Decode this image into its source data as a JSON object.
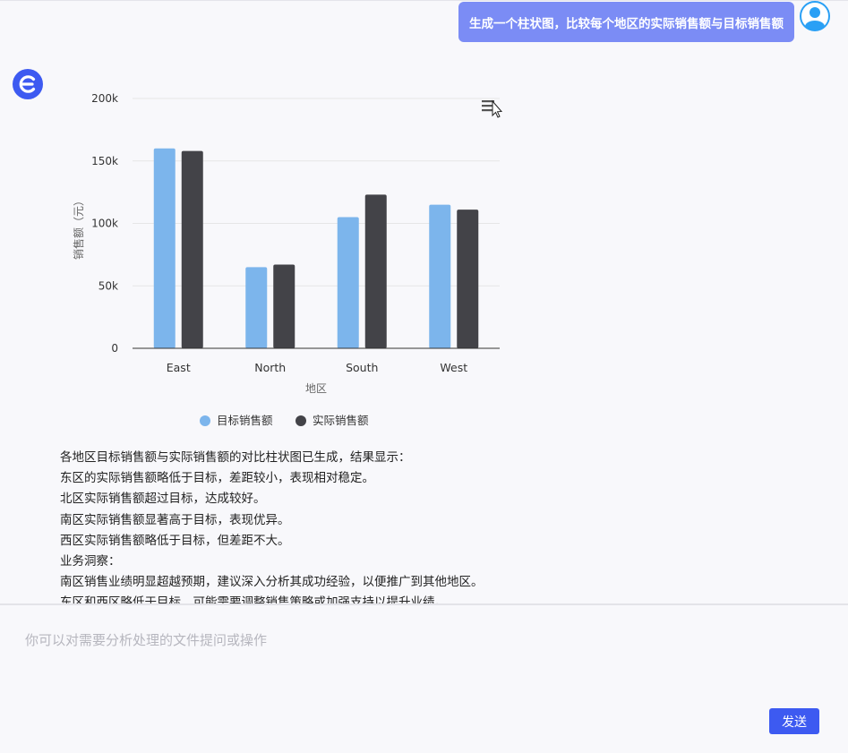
{
  "conversation": {
    "user_message": "生成一个柱状图，比较每个地区的实际销售额与目标销售额"
  },
  "chart_data": {
    "type": "bar",
    "categories": [
      "East",
      "North",
      "South",
      "West"
    ],
    "series": [
      {
        "name": "目标销售额",
        "values": [
          160000,
          65000,
          105000,
          115000
        ],
        "color": "#7cb5ec"
      },
      {
        "name": "实际销售额",
        "values": [
          158000,
          67000,
          123000,
          111000
        ],
        "color": "#434348"
      }
    ],
    "xlabel": "地区",
    "ylabel": "销售额（元）",
    "ylim": [
      0,
      200000
    ],
    "yticks": [
      "0",
      "50k",
      "100k",
      "150k",
      "200k"
    ],
    "grid": true,
    "legend": "bottom-center"
  },
  "chart_menu_icon": "hamburger-menu-icon",
  "answer": {
    "lines": [
      "各地区目标销售额与实际销售额的对比柱状图已生成，结果显示：",
      "东区的实际销售额略低于目标，差距较小，表现相对稳定。",
      "北区实际销售额超过目标，达成较好。",
      "南区实际销售额显著高于目标，表现优异。",
      "西区实际销售额略低于目标，但差距不大。",
      "业务洞察：",
      "南区销售业绩明显超越预期，建议深入分析其成功经验，以便推广到其他地区。",
      "东区和西区略低于目标，可能需要调整销售策略或加强支持以提升业绩。"
    ]
  },
  "input": {
    "placeholder": "你可以对需要分析处理的文件提问或操作"
  },
  "send_label": "发送",
  "colors": {
    "accent": "#3d5af1",
    "user_bubble": "#7b8cf5",
    "avatar_blue": "#2aa0f5"
  }
}
